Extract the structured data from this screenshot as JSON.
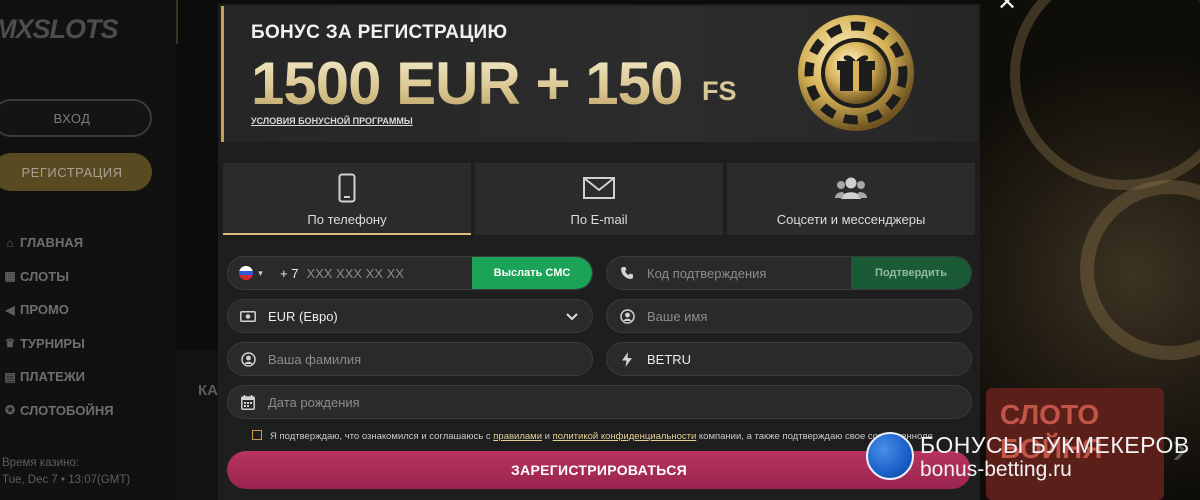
{
  "sidebar": {
    "logo": "MXSLOTS",
    "login_label": "ВХОД",
    "register_label": "РЕГИСТРАЦИЯ",
    "menu": [
      {
        "label": "ГЛАВНАЯ",
        "icon": "home-icon"
      },
      {
        "label": "СЛОТЫ",
        "icon": "slots-icon"
      },
      {
        "label": "ПРОМО",
        "icon": "megaphone-icon"
      },
      {
        "label": "ТУРНИРЫ",
        "icon": "trophy-icon"
      },
      {
        "label": "ПЛАТЕЖИ",
        "icon": "wallet-icon"
      },
      {
        "label": "СЛОТОБОЙНЯ",
        "icon": "slotoboinya-icon"
      }
    ],
    "time_label": "Время казино:",
    "time_value": "Tue, Dec 7 • 13:07(GMT)"
  },
  "background": {
    "section_heading_partial": "КА",
    "promo_text": "СЛОТО\nБОЙНЯ"
  },
  "modal": {
    "banner": {
      "title": "БОНУС ЗА РЕГИСТРАЦИЮ",
      "amount": "1500 EUR + 150",
      "fs": "FS",
      "terms_link": "УСЛОВИЯ БОНУСНОЙ ПРОГРАММЫ"
    },
    "tabs": [
      {
        "label": "По телефону",
        "icon": "phone-icon",
        "active": true
      },
      {
        "label": "По E-mail",
        "icon": "envelope-icon",
        "active": false
      },
      {
        "label": "Соцсети и мессенджеры",
        "icon": "users-icon",
        "active": false
      }
    ],
    "phone": {
      "prefix": "+ 7",
      "placeholder": "XXX XXX XX XX",
      "send_sms": "Выслать СМС"
    },
    "code": {
      "placeholder": "Код подтверждения",
      "confirm": "Подтвердить"
    },
    "currency": {
      "value": "EUR (Евро)"
    },
    "name": {
      "placeholder": "Ваше имя"
    },
    "surname": {
      "placeholder": "Ваша фамилия"
    },
    "promo_code": {
      "value": "BETRU"
    },
    "birthdate": {
      "placeholder": "Дата рождения"
    },
    "consent": {
      "before": "Я подтверждаю, что ознакомился и соглашаюсь с ",
      "rules_link": "правилами",
      "and": " и ",
      "privacy_link": "политикой конфиденциальности",
      "after": " компании, а также подтверждаю свое совершенноле"
    },
    "register_button": "ЗАРЕГИСТРИРОВАТЬСЯ"
  },
  "watermark": {
    "line1": "БОНУСЫ БУКМЕКЕРОВ",
    "line2": "bonus-betting.ru"
  },
  "colors": {
    "accent_gold": "#c6a04c",
    "sms_green": "#1ba457",
    "register_pink": "#b7335e"
  }
}
